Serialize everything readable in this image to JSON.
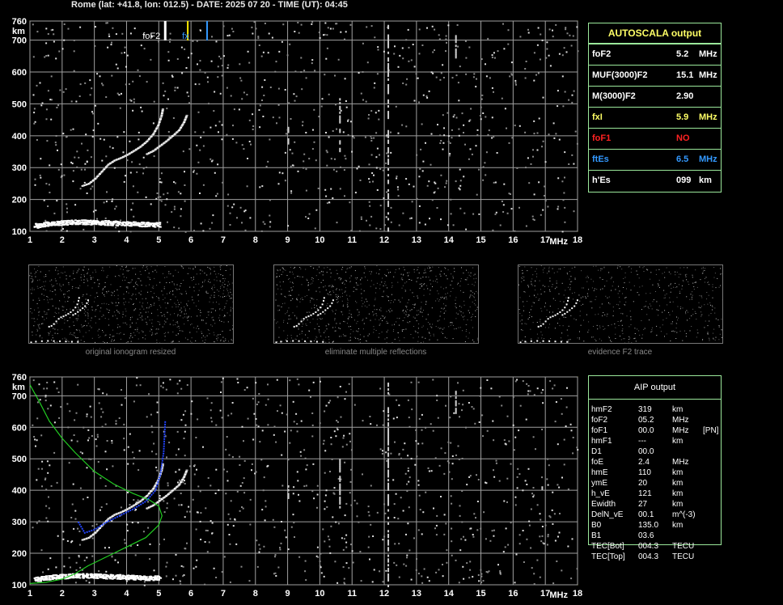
{
  "header": {
    "title": "Rome (lat: +41.8, lon: 012.5) - DATE: 2025 07 20 - TIME (UT): 04:45"
  },
  "colors": {
    "grid": "#a0a0a0",
    "axis_label": "#ffffff",
    "trace_white": "#ffffff",
    "trace_gray": "#bdbdbd",
    "profile_green": "#22cc22",
    "profile_blue": "#2244ff",
    "marker_yellow": "#ffee00",
    "marker_blue": "#3399ff",
    "panel_border": "#9be89b",
    "label_yellow": "#ffff66",
    "label_red": "#ff2222",
    "label_blue": "#3399ff"
  },
  "autoscala": {
    "title": "AUTOSCALA output",
    "rows": [
      {
        "label": "foF2",
        "value": "5.2",
        "unit": "MHz",
        "color": "#ffffff"
      },
      {
        "label": "MUF(3000)F2",
        "value": "15.1",
        "unit": "MHz",
        "color": "#ffffff"
      },
      {
        "label": "M(3000)F2",
        "value": "2.90",
        "unit": "",
        "color": "#ffffff"
      },
      {
        "label": "fxI",
        "value": "5.9",
        "unit": "MHz",
        "color": "#ffff66"
      },
      {
        "label": "foF1",
        "value": "NO",
        "unit": "",
        "color": "#ff2222"
      },
      {
        "label": "ftEs",
        "value": "6.5",
        "unit": "MHz",
        "color": "#3399ff"
      },
      {
        "label": "h'Es",
        "value": "099",
        "unit": "km",
        "color": "#ffffff"
      }
    ]
  },
  "aip": {
    "title": "AIP output",
    "rows": [
      {
        "label": "hmF2",
        "value": "319",
        "unit": "km",
        "extra": ""
      },
      {
        "label": "foF2",
        "value": "05.2",
        "unit": "MHz",
        "extra": ""
      },
      {
        "label": "foF1",
        "value": "00.0",
        "unit": "MHz",
        "extra": "[PN]"
      },
      {
        "label": "hmF1",
        "value": "---",
        "unit": "km",
        "extra": ""
      },
      {
        "label": "D1",
        "value": "00.0",
        "unit": "",
        "extra": ""
      },
      {
        "label": "foE",
        "value": "2.4",
        "unit": "MHz",
        "extra": ""
      },
      {
        "label": "hmE",
        "value": "110",
        "unit": "km",
        "extra": ""
      },
      {
        "label": "ymE",
        "value": "20",
        "unit": "km",
        "extra": ""
      },
      {
        "label": "h_vE",
        "value": "121",
        "unit": "km",
        "extra": ""
      },
      {
        "label": "Ewidth",
        "value": "27",
        "unit": "km",
        "extra": ""
      },
      {
        "label": "DelN_vE",
        "value": "00.1",
        "unit": "m^(-3)",
        "extra": ""
      },
      {
        "label": "B0",
        "value": "135.0",
        "unit": "km",
        "extra": ""
      },
      {
        "label": "B1",
        "value": "03.6",
        "unit": "",
        "extra": ""
      },
      {
        "label": "TEC[Bot]",
        "value": "004.3",
        "unit": "TECU",
        "extra": ""
      },
      {
        "label": "TEC[Top]",
        "value": "004.3",
        "unit": "TECU",
        "extra": ""
      }
    ]
  },
  "thumbnails": [
    {
      "caption": "original ionogram resized"
    },
    {
      "caption": "eliminate multiple reflections"
    },
    {
      "caption": "evidence F2 trace"
    }
  ],
  "markers": {
    "foF2_label": "foF2",
    "fx_label": "fx",
    "foF2": 5.2,
    "fxI": 5.9,
    "ftEs": 6.5
  },
  "chart_data": [
    {
      "type": "scatter",
      "name_hint": "top-ionogram",
      "xlabel": "MHz",
      "ylabel": "km",
      "xlim": [
        1,
        18
      ],
      "ylim": [
        100,
        760
      ],
      "x_ticks": [
        1,
        2,
        3,
        4,
        5,
        6,
        7,
        8,
        9,
        10,
        11,
        12,
        13,
        14,
        15,
        16,
        17,
        18
      ],
      "y_ticks": [
        100,
        200,
        300,
        400,
        500,
        600,
        700,
        760
      ],
      "grid": true,
      "series": [
        {
          "type": "ordinary_trace",
          "x": [
            2.6,
            2.8,
            3.0,
            3.2,
            3.4,
            3.6,
            3.8,
            4.0,
            4.2,
            4.4,
            4.6,
            4.8,
            4.95,
            5.05,
            5.1
          ],
          "y": [
            245,
            252,
            268,
            290,
            312,
            325,
            333,
            343,
            355,
            368,
            385,
            408,
            435,
            465,
            490
          ]
        },
        {
          "type": "extraordinary_trace",
          "x": [
            4.6,
            4.8,
            5.0,
            5.2,
            5.4,
            5.6,
            5.75,
            5.85
          ],
          "y": [
            345,
            355,
            370,
            385,
            402,
            420,
            445,
            470
          ]
        },
        {
          "type": "E_layer",
          "x": [
            1.1,
            1.5,
            2.0,
            2.5,
            3.0,
            3.5,
            4.0,
            4.5,
            5.0
          ],
          "y": [
            112,
            118,
            122,
            124,
            123,
            121,
            119,
            117,
            116
          ]
        }
      ]
    },
    {
      "type": "scatter",
      "name_hint": "bottom-ionogram-profile",
      "xlabel": "MHz",
      "ylabel": "km",
      "xlim": [
        1,
        18
      ],
      "ylim": [
        100,
        760
      ],
      "x_ticks": [
        1,
        2,
        3,
        4,
        5,
        6,
        7,
        8,
        9,
        10,
        11,
        12,
        13,
        14,
        15,
        16,
        17,
        18
      ],
      "y_ticks": [
        100,
        200,
        300,
        400,
        500,
        600,
        700,
        760
      ],
      "grid": true,
      "series": [
        {
          "type": "ordinary_trace",
          "x": [
            2.6,
            2.8,
            3.0,
            3.2,
            3.4,
            3.6,
            3.8,
            4.0,
            4.2,
            4.4,
            4.6,
            4.8,
            4.95,
            5.05,
            5.1
          ],
          "y": [
            245,
            252,
            268,
            290,
            312,
            325,
            333,
            343,
            355,
            368,
            385,
            408,
            435,
            465,
            490
          ]
        },
        {
          "type": "extraordinary_trace",
          "x": [
            4.6,
            4.8,
            5.0,
            5.2,
            5.4,
            5.6,
            5.75,
            5.85
          ],
          "y": [
            345,
            355,
            370,
            385,
            402,
            420,
            445,
            470
          ]
        },
        {
          "type": "E_layer",
          "x": [
            1.1,
            1.5,
            2.0,
            2.5,
            3.0,
            3.5,
            4.0,
            4.5,
            5.0
          ],
          "y": [
            112,
            118,
            122,
            124,
            123,
            121,
            119,
            117,
            116
          ]
        },
        {
          "type": "profile_green",
          "x": [
            1.0,
            1.3,
            1.6,
            2.0,
            2.4,
            3.0,
            3.6,
            4.2,
            4.7,
            5.0,
            5.1,
            5.0,
            4.6,
            4.0,
            3.4,
            2.8,
            2.4,
            2.0,
            1.5,
            1.0
          ],
          "y": [
            735,
            680,
            620,
            565,
            520,
            460,
            420,
            390,
            370,
            350,
            319,
            290,
            250,
            220,
            190,
            160,
            135,
            118,
            108,
            104
          ]
        },
        {
          "type": "profile_blue",
          "x": [
            2.5,
            2.7,
            3.0,
            3.4,
            3.8,
            4.2,
            4.6,
            4.9,
            5.05,
            5.15,
            5.2
          ],
          "y": [
            300,
            265,
            275,
            300,
            320,
            340,
            365,
            400,
            450,
            520,
            620
          ]
        }
      ]
    }
  ]
}
